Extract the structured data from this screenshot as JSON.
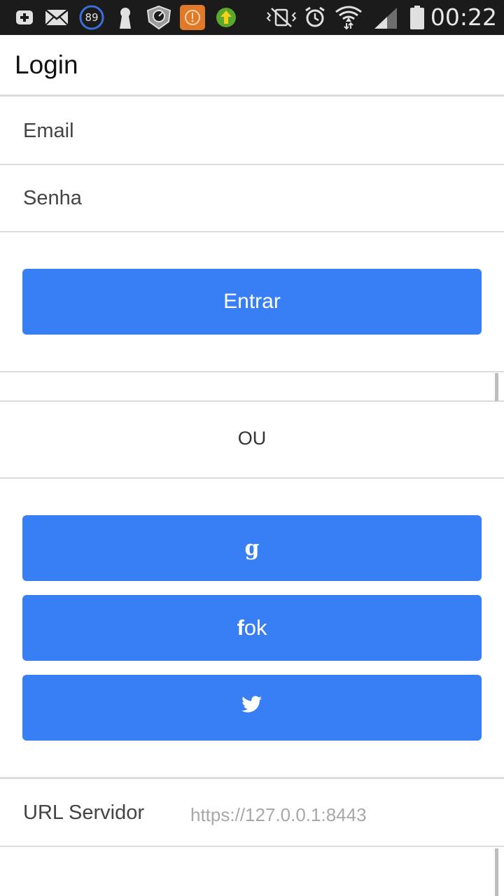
{
  "status_bar": {
    "battery_badge": "89",
    "time": "00:22",
    "icons": [
      "plus-box-icon",
      "mail-icon",
      "battery-circle-icon",
      "keyhole-icon",
      "shield-speed-icon",
      "orange-download-icon",
      "green-upload-icon",
      "vibrate-mute-icon",
      "alarm-icon",
      "wifi-icon",
      "signal-icon",
      "battery-icon"
    ]
  },
  "header": {
    "title": "Login"
  },
  "form": {
    "email_placeholder": "Email",
    "password_placeholder": "Senha",
    "submit_label": "Entrar"
  },
  "separator": {
    "label": "OU"
  },
  "social": {
    "google_label": "g",
    "facebook_prefix": "f",
    "facebook_suffix": "ok",
    "twitter_icon": "twitter-bird-icon"
  },
  "server": {
    "label": "URL Servidor",
    "value": "https://127.0.0.1:8443"
  },
  "colors": {
    "primary": "#387ef5",
    "statusbar": "#1b1b1b",
    "divider": "#dcdcdc"
  }
}
